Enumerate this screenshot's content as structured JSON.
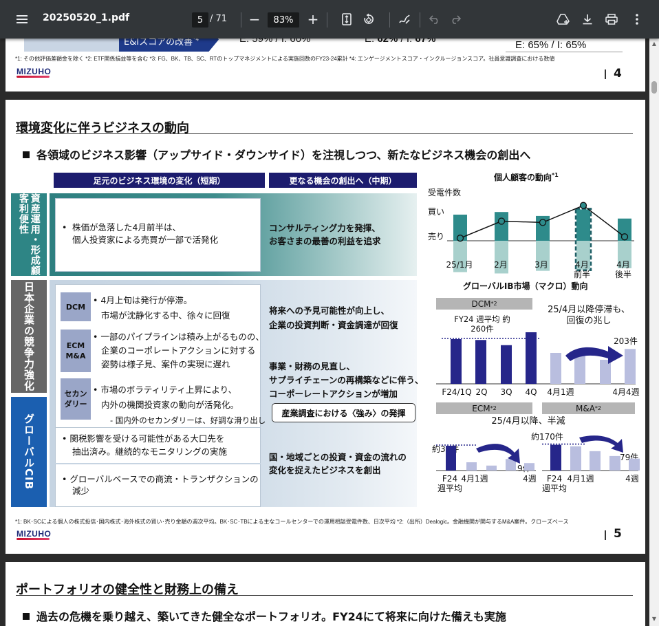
{
  "toolbar": {
    "menu_icon": "hamburger-menu-icon",
    "filename": "20250520_1.pdf",
    "current_page": "5",
    "page_count": "/ 71",
    "zoom_out": "−",
    "zoom_value": "83%",
    "zoom_in": "+",
    "icons": [
      "fit-page-icon",
      "rotate-icon",
      "annotate-pen-icon",
      "undo-icon",
      "redo-icon",
      "add-to-drive-icon",
      "download-icon",
      "print-icon",
      "more-vert-icon"
    ]
  },
  "page4": {
    "arrow_text": "E&Iスコアの改善",
    "arrow_sup": "*4",
    "val1": "E: 59% / I: 60%",
    "val2_prefix": "E: ",
    "val2_a": "62%",
    "val2_mid": " / I: ",
    "val2_b": "67%",
    "val3": "E: 65% / I: 65%",
    "footnote": "*1: その他評価差額金を除く *2: ETF関係損益等を含む *3: FG、BK、TB、SC、RTのトップマネジメントによる実施回数のFY23-24累計 *4: エンゲージメントスコア・インクルージョンスコア。社員意識調査における数値",
    "logo": "MIZUHO",
    "page_number": "4"
  },
  "page5": {
    "title": "環境変化に伴うビジネスの動向",
    "subtitle": "各領域のビジネス影響（アップサイド・ダウンサイド）を注視しつつ、新たなビジネス機会の創出へ",
    "header_short": "足元のビジネス環境の変化（短期）",
    "header_mid": "更なる機会の創出へ（中期）",
    "row1": {
      "label": "資産運用・形成顧客利便性",
      "bullet": "•",
      "text1": "株価が急落した4月前半は、",
      "text2": "個人投資家による売買が一部で活発化",
      "opp1": "コンサルティング力を発揮、",
      "opp2": "お客さまの最善の利益を追求"
    },
    "row2": {
      "label": "日本企業の競争力強化",
      "dcm_tag": "DCM",
      "dcm1": "• 4月上旬は発行が停滞。",
      "dcm2": "市場が沈静化する中、徐々に回復",
      "ecm_tag": "ECM M&A",
      "ecm1": "• 一部のパイプラインは積み上がるものの、",
      "ecm2": "企業のコーポレートアクションに対する",
      "ecm3": "姿勢は様子見、案件の実現に遅れ",
      "sec_tag": "セカンダリー",
      "sec1": "• 市場のボラティリティ上昇により、",
      "sec2": "内外の機関投資家の動向が活発化。",
      "sec3": "- 国内外のセカンダリーは、好調な滑り出し",
      "opp1a": "将来への予見可能性が向上し、",
      "opp1b": "企業の投資判断・資金調達が回復",
      "opp2a": "事業・財務の見直し、",
      "opp2b": "サプライチェーンの再構築などに伴う、",
      "opp2c": "コーポーレートアクションが増加",
      "pill": "産業調査における〈強み〉の発揮"
    },
    "row3": {
      "label": "グローバルCIB",
      "t1a": "• 関税影響を受ける可能性がある大口先を",
      "t1b": "抽出済み。継続的なモニタリングの実施",
      "t2a": "• グローバルベースでの商流・トランザクションの",
      "t2b": "減少",
      "opp1": "国・地域ごとの投資・資金の流れの",
      "opp2": "変化を捉えたビジネスを創出"
    },
    "footnote": "*1: BK･SCによる個人の株式投信･国内株式･海外株式の買い･売り金額の週次平均。BK･SC･TBによる主なコールセンターでの運用相談受電件数、日次平均 *2:（出所）Dealogic。金融機関が関与するM&A案件。クローズベース",
    "logo": "MIZUHO",
    "page_number": "5"
  },
  "chart_data": [
    {
      "type": "bar",
      "title": "個人顧客の動向",
      "title_sup": "*1",
      "categories": [
        "25/1月",
        "2月",
        "3月",
        "4月前半",
        "4月後半"
      ],
      "series": [
        {
          "name": "買い",
          "values": [
            1.0,
            1.1,
            0.95,
            1.2,
            0.85
          ]
        },
        {
          "name": "売り",
          "values": [
            -1.2,
            -1.25,
            -1.15,
            -1.1,
            -1.05
          ]
        },
        {
          "name": "受電件数",
          "values": [
            0.1,
            0.75,
            0.7,
            1.35,
            0.15
          ]
        }
      ],
      "labels": {
        "calls": "受電件数",
        "buy": "買い",
        "sell": "売り"
      }
    },
    {
      "type": "bar",
      "title": "グローバルIB市場（マクロ）動向",
      "panel": "DCM",
      "panel_sup": "*2",
      "note": "25/4月以降停滞も、回復の兆し",
      "avg_label": "FY24 週平均 約260件",
      "end_label": "203件",
      "categories": [
        "F24/1Q",
        "2Q",
        "3Q",
        "4Q",
        "4月1週",
        "",
        "",
        "4月4週"
      ],
      "values": [
        260,
        255,
        225,
        300,
        180,
        165,
        140,
        203
      ]
    },
    {
      "type": "bar",
      "panel": "ECM",
      "panel_sup": "*2",
      "note": "25/4月以降、半減",
      "avg_label": "約30件",
      "end_label": "9件",
      "categories": [
        "F24週平均",
        "4月1週",
        "",
        "",
        "4週"
      ],
      "values": [
        30,
        10,
        6,
        14,
        9
      ]
    },
    {
      "type": "bar",
      "panel": "M&A",
      "panel_sup": "*2",
      "avg_label": "約170件",
      "end_label": "79件",
      "categories": [
        "F24週平均",
        "4月1週",
        "",
        "",
        "4週"
      ],
      "values": [
        170,
        160,
        128,
        96,
        79
      ]
    }
  ],
  "page6": {
    "title": "ポートフォリオの健全性と財務上の備え",
    "subtitle": "過去の危機を乗り越え、築いてきた健全なポートフォリオ。FY24にて将来に向けた備えも実施"
  },
  "colors": {
    "navy": "#1c1c6e",
    "teal": "#2e8b8b",
    "teal_light": "#a8d0cc",
    "bar_navy": "#26268a",
    "bar_light": "#b9bedf",
    "row_grey": "#6b6b6b",
    "row_blue": "#1b5fb0"
  }
}
